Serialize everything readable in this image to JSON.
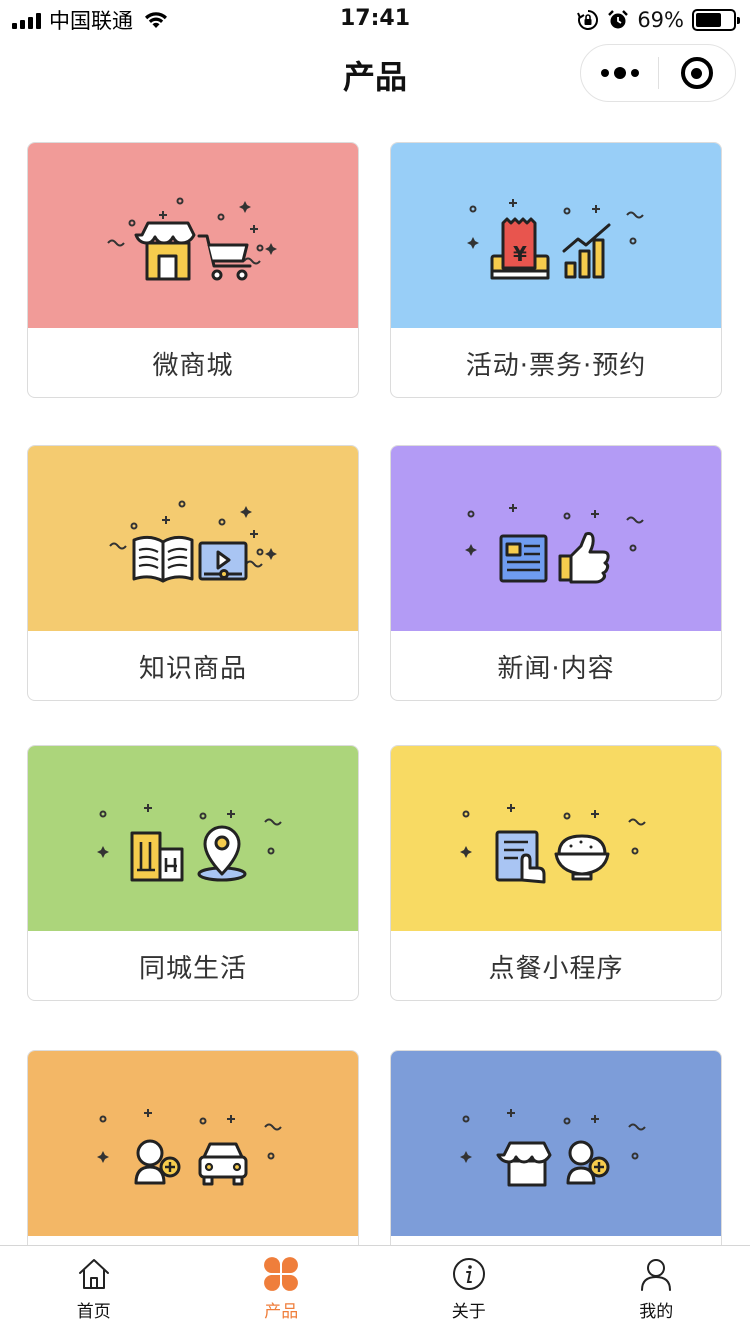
{
  "status_bar": {
    "carrier": "中国联通",
    "time": "17:41",
    "battery": "69%",
    "battery_level": 0.69
  },
  "nav": {
    "title": "产品"
  },
  "cards": [
    {
      "label": "微商城",
      "color": "#f19b98",
      "icon": "shop-cart-icon"
    },
    {
      "label": "活动·票务·预约",
      "color": "#98cef7",
      "icon": "ticket-chart-icon"
    },
    {
      "label": "知识商品",
      "color": "#f4cb70",
      "icon": "book-video-icon"
    },
    {
      "label": "新闻·内容",
      "color": "#b39bf5",
      "icon": "news-thumbsup-icon"
    },
    {
      "label": "同城生活",
      "color": "#acd57b",
      "icon": "building-location-icon"
    },
    {
      "label": "点餐小程序",
      "color": "#f8da63",
      "icon": "menu-bowl-icon"
    },
    {
      "label": "",
      "color": "#f3b766",
      "icon": "user-car-icon"
    },
    {
      "label": "",
      "color": "#7d9dd9",
      "icon": "shop-user-icon"
    }
  ],
  "tabbar": {
    "active_color": "#ef7e3b",
    "items": [
      {
        "label": "首页",
        "icon": "home-icon"
      },
      {
        "label": "产品",
        "icon": "clover-icon",
        "active": true
      },
      {
        "label": "关于",
        "icon": "info-icon"
      },
      {
        "label": "我的",
        "icon": "user-icon"
      }
    ]
  }
}
